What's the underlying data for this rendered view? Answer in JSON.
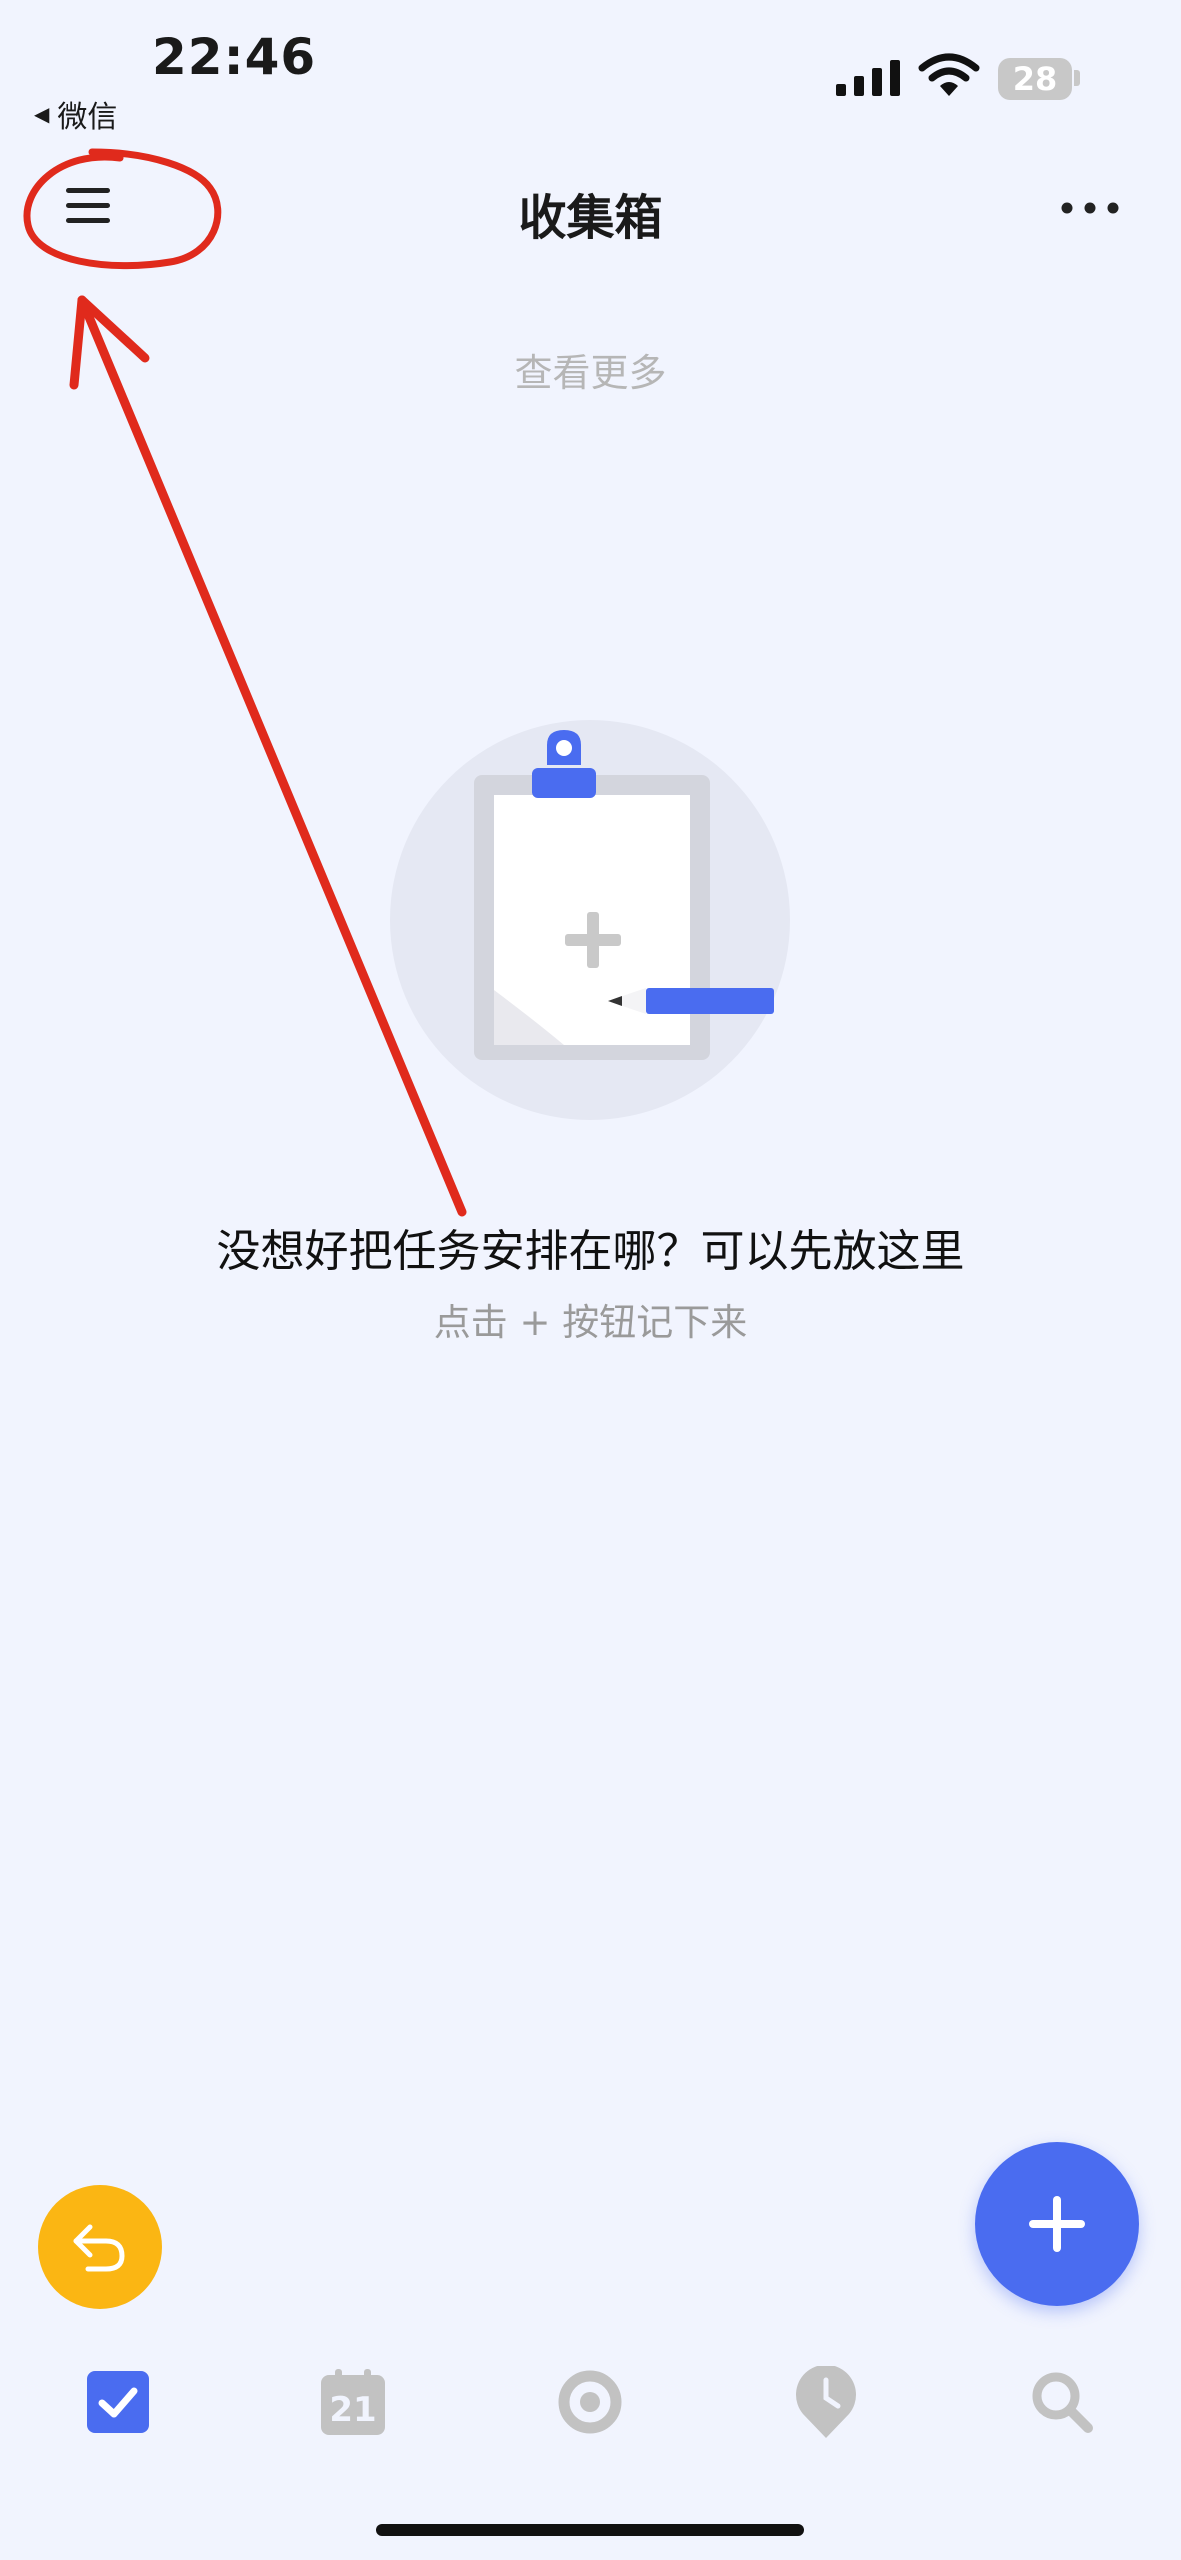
{
  "status_bar": {
    "time": "22:46",
    "back_app": "微信",
    "battery": "28",
    "icons": [
      "cellular-signal-icon",
      "wifi-icon",
      "battery-icon"
    ]
  },
  "nav": {
    "title": "收集箱",
    "menu_icon": "hamburger-menu-icon",
    "more_icon": "more-dots-icon"
  },
  "view_more": "查看更多",
  "empty_state": {
    "illustration": "clipboard-pencil-illustration",
    "title": "没想好把任务安排在哪？可以先放这里",
    "subtitle": "点击 + 按钮记下来"
  },
  "fab": {
    "undo_icon": "undo-arrow-icon",
    "add_icon": "plus-icon"
  },
  "tab_bar": {
    "calendar_day": "21",
    "tabs": [
      {
        "name": "tasks",
        "icon": "checkbox-icon",
        "active": true
      },
      {
        "name": "calendar",
        "icon": "calendar-icon",
        "active": false
      },
      {
        "name": "focus",
        "icon": "pomodoro-icon",
        "active": false
      },
      {
        "name": "habit",
        "icon": "clock-pin-icon",
        "active": false
      },
      {
        "name": "search",
        "icon": "search-icon",
        "active": false
      }
    ]
  },
  "colors": {
    "background": "#f1f4fe",
    "accent": "#4a6cf0",
    "undo": "#fbb613",
    "inactive_icon": "#c2c2c2",
    "annotation": "#e02a1c"
  }
}
